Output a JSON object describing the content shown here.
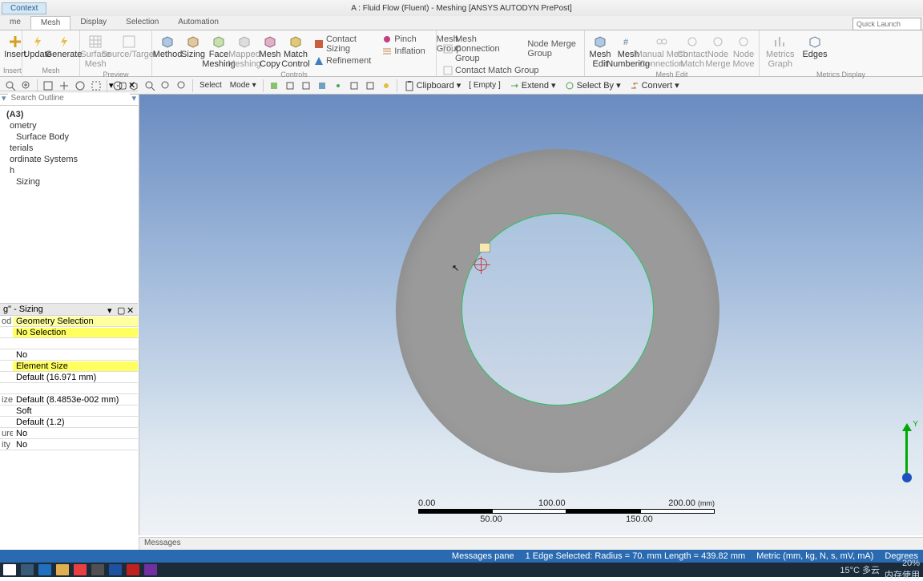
{
  "title": "A : Fluid Flow (Fluent) - Meshing [ANSYS AUTODYN PrePost]",
  "context_tab": "Context",
  "quick_launch_placeholder": "Quick Launch",
  "tabs": {
    "home": "me",
    "mesh": "Mesh",
    "display": "Display",
    "selection": "Selection",
    "automation": "Automation"
  },
  "ribbon": {
    "insert_group": {
      "insert": "Insert",
      "update": "Update",
      "generate": "Generate",
      "label": "Insert"
    },
    "mesh_label": "Mesh",
    "preview_group": {
      "surface_mesh": "Surface\nMesh",
      "source_target": "Source/Target",
      "label": "Preview"
    },
    "controls_group": {
      "method": "Method",
      "sizing": "Sizing",
      "face_meshing": "Face\nMeshing",
      "mapped_meshing": "Mapped\nMeshing",
      "mesh_copy": "Mesh\nCopy",
      "match_control": "Match\nControl",
      "contact_sizing": "Contact Sizing",
      "refinement": "Refinement",
      "pinch": "Pinch",
      "inflation": "Inflation",
      "mesh_group": "Mesh Group",
      "mesh_conn_group": "Mesh Connection Group",
      "contact_match_group": "Contact Match Group",
      "node_merge_group": "Node Merge Group",
      "label": "Controls"
    },
    "meshedit_group": {
      "mesh_edit": "Mesh\nEdit",
      "mesh_numbering": "Mesh\nNumbering",
      "manual_mesh_connection": "Manual Mesh\nConnection",
      "contact_match": "Contact\nMatch",
      "node_merge": "Node\nMerge",
      "node_move": "Node\nMove",
      "label": "Mesh Edit"
    },
    "metrics_group": {
      "metrics_graph": "Metrics\nGraph",
      "edges": "Edges",
      "label": "Metrics Display"
    }
  },
  "toolbar": {
    "select": "Select",
    "mode": "Mode ▾",
    "clipboard": "Clipboard ▾",
    "empty": "[ Empty ]",
    "extend": "Extend ▾",
    "select_by": "Select By ▾",
    "convert": "Convert ▾"
  },
  "outline": {
    "search_placeholder": "Search Outline",
    "root": "(A3)",
    "items": [
      "ometry",
      "Surface Body",
      "terials",
      "ordinate Systems",
      "h",
      "Sizing"
    ]
  },
  "details": {
    "header": "g\" - Sizing",
    "rows": [
      {
        "lab": "od",
        "val": "Geometry Selection",
        "cls": "sel"
      },
      {
        "lab": "",
        "val": "No Selection",
        "cls": "yel"
      },
      {
        "lab": "",
        "val": "",
        "cls": ""
      },
      {
        "lab": "",
        "val": "No",
        "cls": ""
      },
      {
        "lab": "",
        "val": "Element Size",
        "cls": "yel"
      },
      {
        "lab": "",
        "val": "Default (16.971 mm)",
        "cls": ""
      },
      {
        "lab": "",
        "val": "",
        "cls": ""
      },
      {
        "lab": "ize",
        "val": "Default (8.4853e-002 mm)",
        "cls": ""
      },
      {
        "lab": "",
        "val": "Soft",
        "cls": ""
      },
      {
        "lab": "",
        "val": "Default (1.2)",
        "cls": ""
      },
      {
        "lab": "ure",
        "val": "No",
        "cls": ""
      },
      {
        "lab": "ity",
        "val": "No",
        "cls": ""
      }
    ]
  },
  "scale": {
    "t0": "0.00",
    "t1": "100.00",
    "t2": "200.00",
    "unit": "(mm)",
    "b0": "50.00",
    "b1": "150.00"
  },
  "triad": {
    "y": "Y"
  },
  "messages_label": "Messages",
  "status": {
    "messages_pane": "Messages pane",
    "selection": "1 Edge Selected: Radius = 70. mm   Length = 439.82 mm",
    "metric": "Metric (mm, kg, N, s, mV, mA)",
    "degrees": "Degrees"
  },
  "taskbar": {
    "weather": "15°C 多云",
    "pct": "20%",
    "note": "内存使用"
  }
}
